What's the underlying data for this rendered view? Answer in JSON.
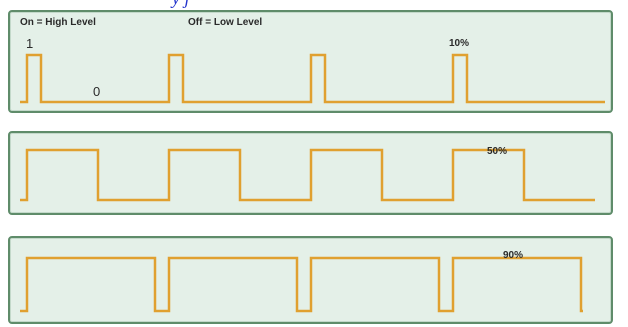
{
  "header_fragment": "y j",
  "legend": {
    "on_label": "On = High Level",
    "off_label": "Off = Low Level"
  },
  "levels": {
    "high": "1",
    "low": "0"
  },
  "panels": [
    {
      "duty_label": "10%",
      "duty_cycle": 0.1
    },
    {
      "duty_label": "50%",
      "duty_cycle": 0.5
    },
    {
      "duty_label": "90%",
      "duty_cycle": 0.9
    }
  ],
  "colors": {
    "waveform": "#e0a030",
    "panel_border": "#5f8c6a",
    "panel_fill": "#e4f0e8"
  }
}
